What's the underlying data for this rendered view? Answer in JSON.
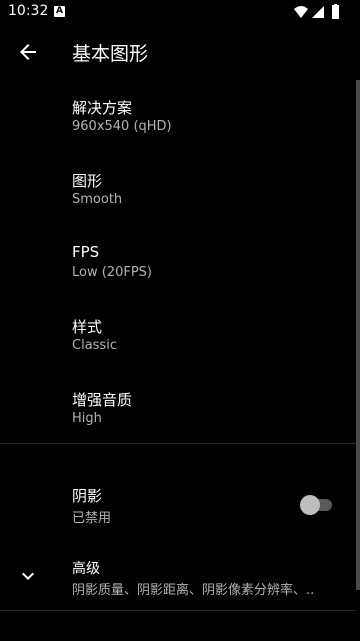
{
  "status_bar": {
    "time": "10:32",
    "notification_icon": "A"
  },
  "app_bar": {
    "title": "基本图形"
  },
  "settings": [
    {
      "label": "解决方案",
      "value": "960x540 (qHD)"
    },
    {
      "label": "图形",
      "value": "Smooth"
    },
    {
      "label": "FPS",
      "value": "Low (20FPS)"
    },
    {
      "label": "样式",
      "value": "Classic"
    },
    {
      "label": "增强音质",
      "value": "High"
    }
  ],
  "shadow": {
    "label": "阴影",
    "value": "已禁用",
    "enabled": false
  },
  "advanced": {
    "label": "高级",
    "summary": "阴影质量、阴影距离、阴影像素分辨率、.."
  },
  "colors": {
    "background": "#000000",
    "primary_text": "#ffffff",
    "secondary_text": "#b3b3b3",
    "divider": "#2a2a2a"
  }
}
